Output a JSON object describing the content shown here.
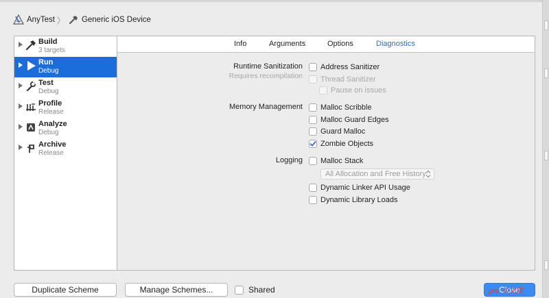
{
  "breadcrumb": {
    "project": "AnyTest",
    "destination": "Generic iOS Device",
    "separator": "〉"
  },
  "sidebar": {
    "items": [
      {
        "title": "Build",
        "subtitle": "3 targets",
        "icon": "hammer-icon"
      },
      {
        "title": "Run",
        "subtitle": "Debug",
        "icon": "play-icon",
        "selected": true
      },
      {
        "title": "Test",
        "subtitle": "Debug",
        "icon": "wrench-icon"
      },
      {
        "title": "Profile",
        "subtitle": "Release",
        "icon": "gauge-icon"
      },
      {
        "title": "Analyze",
        "subtitle": "Debug",
        "icon": "analyze-icon"
      },
      {
        "title": "Archive",
        "subtitle": "Release",
        "icon": "archive-icon"
      }
    ]
  },
  "tabs": [
    {
      "label": "Info"
    },
    {
      "label": "Arguments"
    },
    {
      "label": "Options"
    },
    {
      "label": "Diagnostics",
      "active": true
    }
  ],
  "diagnostics": {
    "runtime_sanitization": {
      "label": "Runtime Sanitization",
      "sublabel": "Requires recompilation",
      "address_sanitizer": {
        "label": "Address Sanitizer",
        "checked": false
      },
      "thread_sanitizer": {
        "label": "Thread Sanitizer",
        "checked": false,
        "disabled": true
      },
      "pause_on_issues": {
        "label": "Pause on issues",
        "checked": false,
        "disabled": true
      }
    },
    "memory_management": {
      "label": "Memory Management",
      "malloc_scribble": {
        "label": "Malloc Scribble",
        "checked": false
      },
      "malloc_guard_edges": {
        "label": "Malloc Guard Edges",
        "checked": false
      },
      "guard_malloc": {
        "label": "Guard Malloc",
        "checked": false
      },
      "zombie_objects": {
        "label": "Zombie Objects",
        "checked": true
      }
    },
    "logging": {
      "label": "Logging",
      "malloc_stack": {
        "label": "Malloc Stack",
        "checked": false
      },
      "malloc_stack_mode": {
        "value": "All Allocation and Free History",
        "disabled": true
      },
      "dynamic_linker_api_usage": {
        "label": "Dynamic Linker API Usage",
        "checked": false
      },
      "dynamic_library_loads": {
        "label": "Dynamic Library Loads",
        "checked": false
      }
    }
  },
  "footer": {
    "duplicate_scheme": "Duplicate Scheme",
    "manage_schemes": "Manage Schemes...",
    "shared_label": "Shared",
    "shared_checked": false,
    "close": "Close",
    "watermark": "php 中文网"
  },
  "colors": {
    "accent": "#1b6ddb",
    "tab_active": "#2a6dc8",
    "close_button": "#3a8bf4",
    "checkmark": "#2f6fd6"
  }
}
